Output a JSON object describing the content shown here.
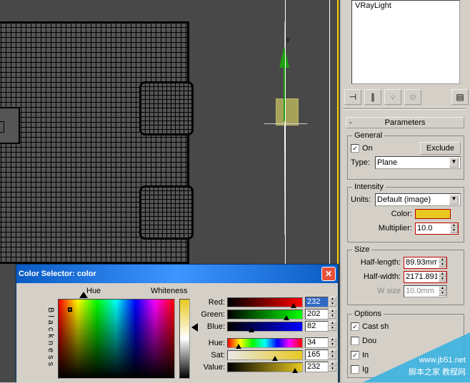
{
  "object_name": "VRayLight",
  "rollout": {
    "parameters": "Parameters"
  },
  "general": {
    "title": "General",
    "on_label": "On",
    "on_checked": true,
    "exclude_label": "Exclude",
    "type_label": "Type:",
    "type_value": "Plane"
  },
  "intensity": {
    "title": "Intensity",
    "units_label": "Units:",
    "units_value": "Default (image)",
    "color_label": "Color:",
    "color_hex": "#e8c820",
    "multiplier_label": "Multiplier:",
    "multiplier_value": "10.0"
  },
  "size": {
    "title": "Size",
    "half_length_label": "Half-length:",
    "half_length_value": "89.93mm",
    "half_width_label": "Half-width:",
    "half_width_value": "2171.891",
    "w_size_label": "W size",
    "w_size_value": "10.0mm"
  },
  "options": {
    "title": "Options",
    "cast_label": "Cast sh",
    "cast_checked": true,
    "dou_label": "Dou",
    "dou_checked": false,
    "inv_label": "In",
    "inv_checked": true,
    "ig_label": "Ig",
    "ig_checked": false
  },
  "color_selector": {
    "title": "Color Selector: color",
    "hue_label": "Hue",
    "whiteness_label": "Whiteness",
    "blackness_label": "Blackness",
    "red": {
      "label": "Red:",
      "value": "232"
    },
    "green": {
      "label": "Green:",
      "value": "202"
    },
    "blue": {
      "label": "Blue:",
      "value": "82"
    },
    "hue": {
      "label": "Hue:",
      "value": "34"
    },
    "sat": {
      "label": "Sat:",
      "value": "165"
    },
    "value": {
      "label": "Value:",
      "value": "232"
    }
  },
  "watermark": {
    "line1": "www.jb51.net",
    "line2": "脚本之家 教程网"
  }
}
